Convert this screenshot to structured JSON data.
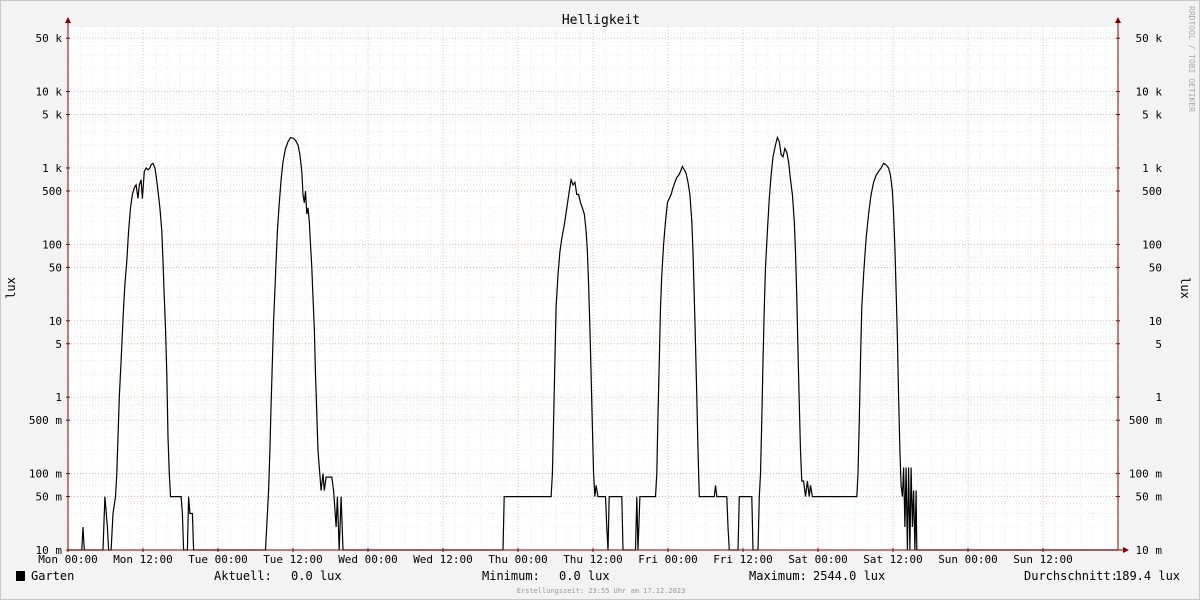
{
  "watermark": "RRDTOOL / TOBI OETIKER",
  "footer_note": "Erstellungszeit: 23:55 Uhr am 17.12.2023",
  "legend": {
    "series_name": "Garten",
    "swatch_color": "#000000",
    "current_label": "Aktuell:",
    "current_value": "0.0 lux",
    "min_label": "Minimum:",
    "min_value": "0.0 lux",
    "max_label": "Maximum:",
    "max_value": "2544.0 lux",
    "avg_label": "Durchschnitt:",
    "avg_value": "189.4 lux"
  },
  "colors": {
    "background": "#f3f3f3",
    "canvas": "#ffffff",
    "grid_major": "#e8a0a0",
    "grid_minor": "#dddddd",
    "axis": "#8b0000",
    "line": "#000000",
    "text": "#000000",
    "watermark": "#aaaaaa"
  },
  "chart_data": {
    "type": "line",
    "title": "Helligkeit",
    "ylabel": "lux",
    "yscale": "log",
    "ylim": [
      0.01,
      70000
    ],
    "xlim": [
      0,
      168
    ],
    "x_unit": "hours since Mon 00:00",
    "x_ticks": [
      {
        "value": 0,
        "label": "Mon 00:00"
      },
      {
        "value": 12,
        "label": "Mon 12:00"
      },
      {
        "value": 24,
        "label": "Tue 00:00"
      },
      {
        "value": 36,
        "label": "Tue 12:00"
      },
      {
        "value": 48,
        "label": "Wed 00:00"
      },
      {
        "value": 60,
        "label": "Wed 12:00"
      },
      {
        "value": 72,
        "label": "Thu 00:00"
      },
      {
        "value": 84,
        "label": "Thu 12:00"
      },
      {
        "value": 96,
        "label": "Fri 00:00"
      },
      {
        "value": 108,
        "label": "Fri 12:00"
      },
      {
        "value": 120,
        "label": "Sat 00:00"
      },
      {
        "value": 132,
        "label": "Sat 12:00"
      },
      {
        "value": 144,
        "label": "Sun 00:00"
      },
      {
        "value": 156,
        "label": "Sun 12:00"
      }
    ],
    "y_ticks": [
      {
        "value": 50000,
        "label": "50 k"
      },
      {
        "value": 10000,
        "label": "10 k"
      },
      {
        "value": 5000,
        "label": "5 k"
      },
      {
        "value": 1000,
        "label": "1 k"
      },
      {
        "value": 500,
        "label": "500"
      },
      {
        "value": 100,
        "label": "100"
      },
      {
        "value": 50,
        "label": "50"
      },
      {
        "value": 10,
        "label": "10"
      },
      {
        "value": 5,
        "label": "5"
      },
      {
        "value": 1,
        "label": "1"
      },
      {
        "value": 0.5,
        "label": "500 m"
      },
      {
        "value": 0.1,
        "label": "100 m"
      },
      {
        "value": 0.05,
        "label": "50 m"
      },
      {
        "value": 0.01,
        "label": "10 m"
      }
    ],
    "grid": true,
    "series": [
      {
        "name": "Garten",
        "color": "#000000",
        "points": [
          [
            0,
            0.01
          ],
          [
            2.2,
            0.01
          ],
          [
            2.4,
            0.02
          ],
          [
            2.6,
            0.01
          ],
          [
            5.6,
            0.01
          ],
          [
            5.9,
            0.05
          ],
          [
            6.3,
            0.02
          ],
          [
            6.5,
            0.01
          ],
          [
            6.9,
            0.01
          ],
          [
            7.2,
            0.03
          ],
          [
            7.6,
            0.05
          ],
          [
            7.8,
            0.1
          ],
          [
            8.0,
            0.3
          ],
          [
            8.2,
            1
          ],
          [
            8.5,
            3
          ],
          [
            8.7,
            7
          ],
          [
            8.9,
            15
          ],
          [
            9.1,
            30
          ],
          [
            9.4,
            60
          ],
          [
            9.7,
            150
          ],
          [
            10.0,
            300
          ],
          [
            10.3,
            450
          ],
          [
            10.6,
            550
          ],
          [
            10.9,
            600
          ],
          [
            11.2,
            400
          ],
          [
            11.4,
            600
          ],
          [
            11.7,
            700
          ],
          [
            11.9,
            400
          ],
          [
            12.2,
            900
          ],
          [
            12.5,
            1000
          ],
          [
            12.8,
            950
          ],
          [
            13.1,
            1000
          ],
          [
            13.3,
            1100
          ],
          [
            13.6,
            1150
          ],
          [
            13.9,
            1000
          ],
          [
            14.1,
            800
          ],
          [
            14.4,
            500
          ],
          [
            14.7,
            300
          ],
          [
            15.0,
            150
          ],
          [
            15.2,
            60
          ],
          [
            15.4,
            20
          ],
          [
            15.6,
            8
          ],
          [
            15.8,
            2
          ],
          [
            16.0,
            0.3
          ],
          [
            16.2,
            0.1
          ],
          [
            16.4,
            0.05
          ],
          [
            17.8,
            0.05
          ],
          [
            18.1,
            0.05
          ],
          [
            18.3,
            0.03
          ],
          [
            18.5,
            0.01
          ],
          [
            19.1,
            0.01
          ],
          [
            19.3,
            0.05
          ],
          [
            19.5,
            0.03
          ],
          [
            19.9,
            0.03
          ],
          [
            20.1,
            0.01
          ],
          [
            31.6,
            0.01
          ],
          [
            31.9,
            0.03
          ],
          [
            32.1,
            0.06
          ],
          [
            32.3,
            0.2
          ],
          [
            32.5,
            0.8
          ],
          [
            32.7,
            3
          ],
          [
            32.9,
            10
          ],
          [
            33.1,
            25
          ],
          [
            33.3,
            60
          ],
          [
            33.5,
            150
          ],
          [
            33.8,
            350
          ],
          [
            34.1,
            700
          ],
          [
            34.4,
            1200
          ],
          [
            34.8,
            1800
          ],
          [
            35.2,
            2200
          ],
          [
            35.6,
            2500
          ],
          [
            36.0,
            2450
          ],
          [
            36.4,
            2300
          ],
          [
            36.8,
            2000
          ],
          [
            37.1,
            1500
          ],
          [
            37.4,
            900
          ],
          [
            37.6,
            450
          ],
          [
            37.8,
            350
          ],
          [
            38.0,
            500
          ],
          [
            38.2,
            250
          ],
          [
            38.4,
            300
          ],
          [
            38.6,
            200
          ],
          [
            38.8,
            100
          ],
          [
            39.0,
            50
          ],
          [
            39.2,
            20
          ],
          [
            39.4,
            8
          ],
          [
            39.6,
            2
          ],
          [
            39.8,
            0.6
          ],
          [
            40.0,
            0.2
          ],
          [
            40.2,
            0.12
          ],
          [
            40.5,
            0.06
          ],
          [
            40.8,
            0.1
          ],
          [
            41.0,
            0.06
          ],
          [
            41.3,
            0.09
          ],
          [
            42.2,
            0.09
          ],
          [
            42.5,
            0.06
          ],
          [
            42.9,
            0.02
          ],
          [
            43.1,
            0.05
          ],
          [
            43.4,
            0.01
          ],
          [
            43.7,
            0.05
          ],
          [
            44.0,
            0.01
          ],
          [
            69.6,
            0.01
          ],
          [
            69.8,
            0.05
          ],
          [
            77.3,
            0.05
          ],
          [
            77.5,
            0.1
          ],
          [
            77.7,
            0.5
          ],
          [
            77.9,
            3
          ],
          [
            78.1,
            15
          ],
          [
            78.4,
            40
          ],
          [
            78.7,
            80
          ],
          [
            79.0,
            120
          ],
          [
            79.4,
            180
          ],
          [
            79.8,
            300
          ],
          [
            80.2,
            500
          ],
          [
            80.5,
            700
          ],
          [
            80.8,
            600
          ],
          [
            81.1,
            650
          ],
          [
            81.4,
            450
          ],
          [
            81.7,
            450
          ],
          [
            82.0,
            350
          ],
          [
            82.3,
            300
          ],
          [
            82.6,
            250
          ],
          [
            82.9,
            150
          ],
          [
            83.1,
            80
          ],
          [
            83.3,
            30
          ],
          [
            83.5,
            8
          ],
          [
            83.7,
            2
          ],
          [
            83.9,
            0.4
          ],
          [
            84.1,
            0.1
          ],
          [
            84.3,
            0.05
          ],
          [
            84.5,
            0.07
          ],
          [
            84.8,
            0.05
          ],
          [
            86.0,
            0.05
          ],
          [
            86.2,
            0.02
          ],
          [
            86.4,
            0.01
          ],
          [
            86.6,
            0.05
          ],
          [
            88.6,
            0.05
          ],
          [
            88.8,
            0.01
          ],
          [
            90.8,
            0.01
          ],
          [
            91.0,
            0.05
          ],
          [
            91.2,
            0.01
          ],
          [
            91.5,
            0.05
          ],
          [
            94.0,
            0.05
          ],
          [
            94.2,
            0.1
          ],
          [
            94.4,
            0.6
          ],
          [
            94.6,
            3
          ],
          [
            94.8,
            15
          ],
          [
            95.0,
            40
          ],
          [
            95.3,
            100
          ],
          [
            95.6,
            200
          ],
          [
            95.9,
            350
          ],
          [
            96.2,
            400
          ],
          [
            96.5,
            450
          ],
          [
            96.8,
            550
          ],
          [
            97.1,
            650
          ],
          [
            97.4,
            750
          ],
          [
            97.7,
            800
          ],
          [
            98.0,
            900
          ],
          [
            98.3,
            1050
          ],
          [
            98.6,
            950
          ],
          [
            98.9,
            850
          ],
          [
            99.2,
            650
          ],
          [
            99.5,
            450
          ],
          [
            99.8,
            200
          ],
          [
            100.0,
            80
          ],
          [
            100.2,
            20
          ],
          [
            100.4,
            5
          ],
          [
            100.6,
            1
          ],
          [
            100.8,
            0.2
          ],
          [
            101.0,
            0.05
          ],
          [
            103.4,
            0.05
          ],
          [
            103.6,
            0.07
          ],
          [
            103.8,
            0.05
          ],
          [
            105.4,
            0.05
          ],
          [
            105.6,
            0.02
          ],
          [
            105.8,
            0.01
          ],
          [
            107.2,
            0.01
          ],
          [
            107.4,
            0.05
          ],
          [
            109.4,
            0.05
          ],
          [
            109.6,
            0.01
          ],
          [
            110.4,
            0.01
          ],
          [
            110.6,
            0.05
          ],
          [
            110.8,
            0.1
          ],
          [
            111.0,
            0.5
          ],
          [
            111.2,
            3
          ],
          [
            111.4,
            15
          ],
          [
            111.6,
            50
          ],
          [
            111.9,
            150
          ],
          [
            112.2,
            400
          ],
          [
            112.5,
            800
          ],
          [
            112.8,
            1400
          ],
          [
            113.2,
            2000
          ],
          [
            113.5,
            2500
          ],
          [
            113.8,
            2200
          ],
          [
            114.1,
            1500
          ],
          [
            114.4,
            1400
          ],
          [
            114.7,
            1800
          ],
          [
            115.0,
            1600
          ],
          [
            115.3,
            1200
          ],
          [
            115.6,
            700
          ],
          [
            115.9,
            450
          ],
          [
            116.2,
            200
          ],
          [
            116.4,
            80
          ],
          [
            116.6,
            20
          ],
          [
            116.8,
            4
          ],
          [
            117.0,
            0.8
          ],
          [
            117.2,
            0.2
          ],
          [
            117.4,
            0.08
          ],
          [
            117.7,
            0.08
          ],
          [
            118.0,
            0.05
          ],
          [
            118.3,
            0.08
          ],
          [
            118.6,
            0.05
          ],
          [
            118.8,
            0.07
          ],
          [
            119.1,
            0.05
          ],
          [
            126.2,
            0.05
          ],
          [
            126.4,
            0.1
          ],
          [
            126.6,
            0.5
          ],
          [
            126.8,
            3
          ],
          [
            127.0,
            15
          ],
          [
            127.3,
            40
          ],
          [
            127.7,
            120
          ],
          [
            128.1,
            250
          ],
          [
            128.5,
            450
          ],
          [
            128.9,
            650
          ],
          [
            129.3,
            800
          ],
          [
            129.7,
            900
          ],
          [
            130.1,
            1000
          ],
          [
            130.5,
            1150
          ],
          [
            130.9,
            1100
          ],
          [
            131.3,
            1000
          ],
          [
            131.6,
            800
          ],
          [
            131.9,
            500
          ],
          [
            132.1,
            250
          ],
          [
            132.3,
            90
          ],
          [
            132.5,
            25
          ],
          [
            132.7,
            6
          ],
          [
            132.9,
            1
          ],
          [
            133.1,
            0.2
          ],
          [
            133.3,
            0.07
          ],
          [
            133.5,
            0.05
          ],
          [
            133.7,
            0.12
          ],
          [
            133.9,
            0.02
          ],
          [
            134.1,
            0.12
          ],
          [
            134.3,
            0.01
          ],
          [
            134.5,
            0.12
          ],
          [
            134.7,
            0.01
          ],
          [
            134.9,
            0.12
          ],
          [
            135.1,
            0.02
          ],
          [
            135.3,
            0.06
          ],
          [
            135.5,
            0.01
          ],
          [
            135.7,
            0.06
          ],
          [
            135.8,
            0.01
          ],
          [
            167.9,
            0.01
          ],
          [
            168,
            0.01
          ]
        ]
      }
    ]
  }
}
